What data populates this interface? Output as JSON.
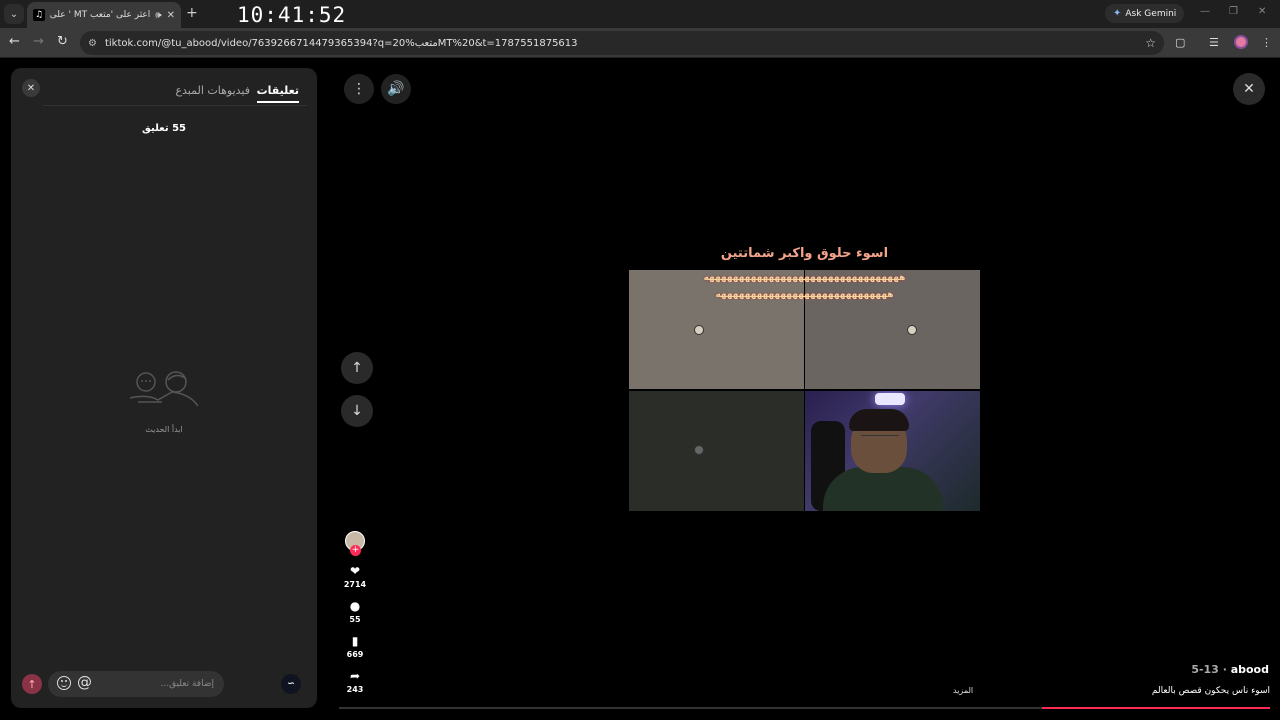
{
  "browser": {
    "tab_title": "اعثر على 'متعب MT ' على تيك توك",
    "new_tab": "+",
    "clock": "10:41:52",
    "ask_gemini": "Ask Gemini",
    "url": "tiktok.com/@tu_abood/video/7639266714479365394?q=20%متعبMT%20&t=1787551875613"
  },
  "panel": {
    "tab_comments": "تعليقات",
    "tab_creator_videos": "فيديوهات المبدع",
    "comment_count": "55 تعليق",
    "empty_state": "ابدأ الحديث",
    "input_placeholder": "إضافة تعليق...",
    "at_symbol": "@"
  },
  "video": {
    "caption": "اسوء حلوق واكبر شماتتين",
    "overlay_line_1": "هههههههههههههههههههههههههههههههههه",
    "overlay_line_2": "هههههههههههههههههههههههههههههه",
    "progress_fraction": 0.245
  },
  "actions": {
    "likes": "2714",
    "comments": "55",
    "saves": "669",
    "shares": "243"
  },
  "post": {
    "author": "abood",
    "date": "5-13",
    "description": "اسوء ناس يحكون قصص بالعالم",
    "more": "المزيد"
  },
  "colors": {
    "accent": "#fe2c55",
    "caption": "#f2a48a"
  }
}
